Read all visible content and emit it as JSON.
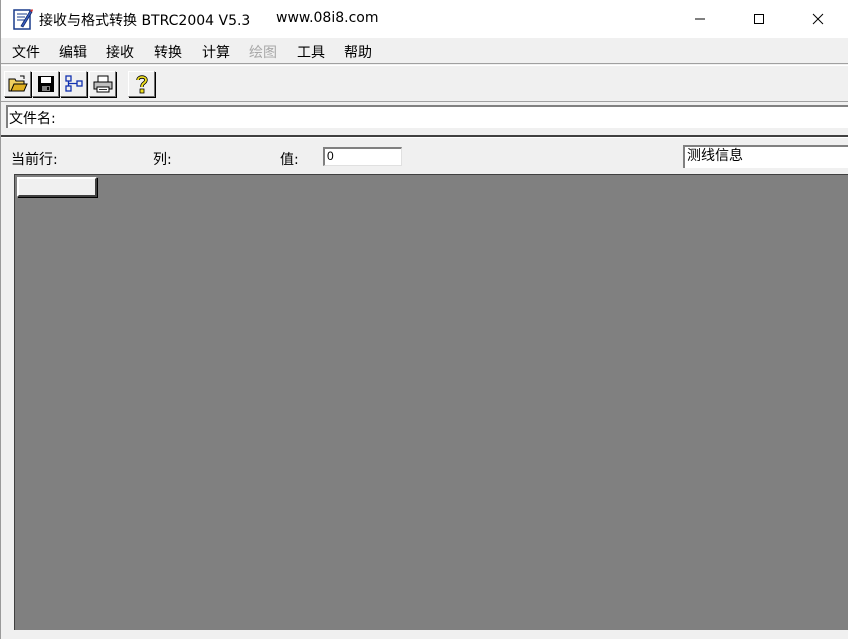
{
  "window": {
    "title": "接收与格式转换 BTRC2004 V5.3",
    "url": "www.08i8.com"
  },
  "menu": {
    "items": [
      {
        "label": "文件",
        "enabled": true
      },
      {
        "label": "编辑",
        "enabled": true
      },
      {
        "label": "接收",
        "enabled": true
      },
      {
        "label": "转换",
        "enabled": true
      },
      {
        "label": "计算",
        "enabled": true
      },
      {
        "label": "绘图",
        "enabled": false
      },
      {
        "label": "工具",
        "enabled": true
      },
      {
        "label": "帮助",
        "enabled": true
      }
    ]
  },
  "toolbar": {
    "buttons": [
      {
        "icon": "open-folder-icon"
      },
      {
        "icon": "save-disk-icon"
      },
      {
        "icon": "connect-icon"
      },
      {
        "icon": "printer-icon"
      },
      {
        "icon": "help-question-icon"
      }
    ]
  },
  "file": {
    "label": "文件名:"
  },
  "info": {
    "current_row_label": "当前行:",
    "column_label": "列:",
    "value_label": "值:",
    "value": "0",
    "dropdown_value": "测线信息"
  },
  "colors": {
    "grid_background": "#808080",
    "chrome": "#f0f0f0"
  }
}
